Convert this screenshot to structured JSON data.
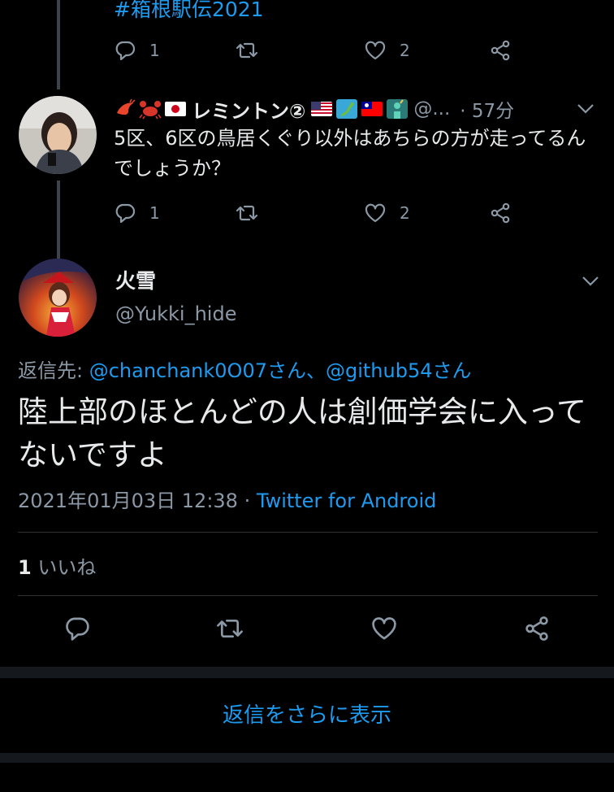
{
  "prev_tweet": {
    "hashtag": "#箱根駅伝2021",
    "reply_count": "1",
    "like_count": "2"
  },
  "reply_tweet": {
    "display_name": "レミントン②",
    "handle": "@...",
    "time": "· 57分",
    "text": "5区、6区の鳥居くぐり以外はあちらの方が走ってるんでしょうか？",
    "reply_count": "1",
    "like_count": "2",
    "emoji_icons": [
      "shrimp-emoji",
      "crab-emoji",
      "japan-flag-emoji",
      "us-flag-emoji",
      "japan-map-emoji",
      "taiwan-flag-emoji",
      "statue-of-liberty-emoji"
    ]
  },
  "main_tweet": {
    "display_name": "火雪",
    "handle": "@Yukki_hide",
    "replying_label": "返信先:",
    "mention1": "@chanchank0O07さん",
    "separator": "、",
    "mention2": "@github54さん",
    "text": "陸上部のほとんどの人は創価学会に入ってないですよ",
    "timestamp": "2021年01月03日 12:38",
    "source_separator": "·",
    "source": "Twitter for Android",
    "likes_count": "1",
    "likes_label": "いいね"
  },
  "more_replies_label": "返信をさらに表示",
  "colors": {
    "background": "#000000",
    "accent": "#1d9bf0",
    "text_primary": "#e7e9ea",
    "text_secondary": "#8b98a5"
  }
}
